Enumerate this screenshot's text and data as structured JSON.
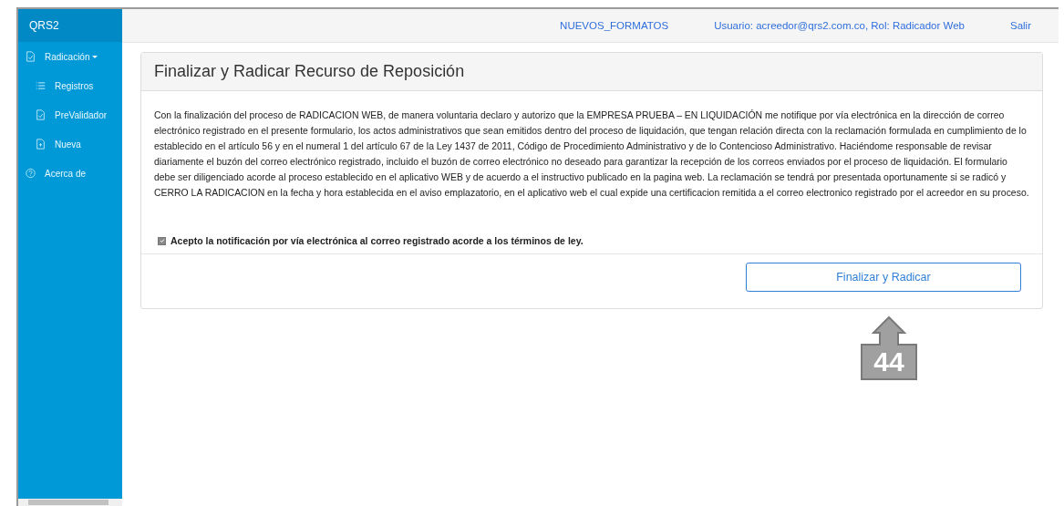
{
  "sidebar": {
    "brand": "QRS2",
    "items": [
      {
        "label": "Radicación",
        "kind": "check",
        "dropdown": true,
        "children": [
          {
            "label": "Registros",
            "kind": "list"
          },
          {
            "label": "PreValidador",
            "kind": "check"
          },
          {
            "label": "Nueva",
            "kind": "add"
          }
        ]
      },
      {
        "label": "Acerca de",
        "kind": "help",
        "dropdown": false
      }
    ]
  },
  "topbar": {
    "links": [
      "NUEVOS_FORMATOS",
      "Usuario: acreedor@qrs2.com.co, Rol: Radicador Web",
      "Salir"
    ]
  },
  "panel": {
    "title": "Finalizar y Radicar Recurso de Reposición",
    "paragraph": "Con la finalización del proceso de RADICACION WEB, de manera voluntaria declaro y autorizo que la EMPRESA PRUEBA – EN LIQUIDACIÓN me notifique por vía electrónica en la dirección de correo electrónico registrado en el presente formulario, los actos administrativos que sean emitidos dentro del proceso de liquidación, que tengan relación directa con la reclamación formulada en cumplimiento de lo establecido en el artículo 56 y en el numeral 1 del artículo 67 de la Ley 1437 de 2011, Código de Procedimiento Administrativo y de lo Contencioso Administrativo. Haciéndome responsable de revisar diariamente el buzón del correo electrónico registrado, incluido el buzón de correo electrónico no deseado para garantizar la recepción de los correos enviados por el proceso de liquidación. El formulario debe ser diligenciado acorde al proceso establecido en el aplicativo WEB y de acuerdo a el instructivo publicado en la pagina web. La reclamación se tendrá por presentada oportunamente si se radicó y CERRO LA RADICACION en la fecha y hora establecida en el aviso emplazatorio, en el aplicativo web el cual expide una certificacion remitida a el correo electronico registrado por el acreedor en su proceso.",
    "consent": {
      "label": "Acepto la notificación por vía electrónica al correo registrado acorde a los términos de ley.",
      "checked": true
    },
    "button": "Finalizar y Radicar"
  },
  "callout": {
    "label": "44"
  }
}
